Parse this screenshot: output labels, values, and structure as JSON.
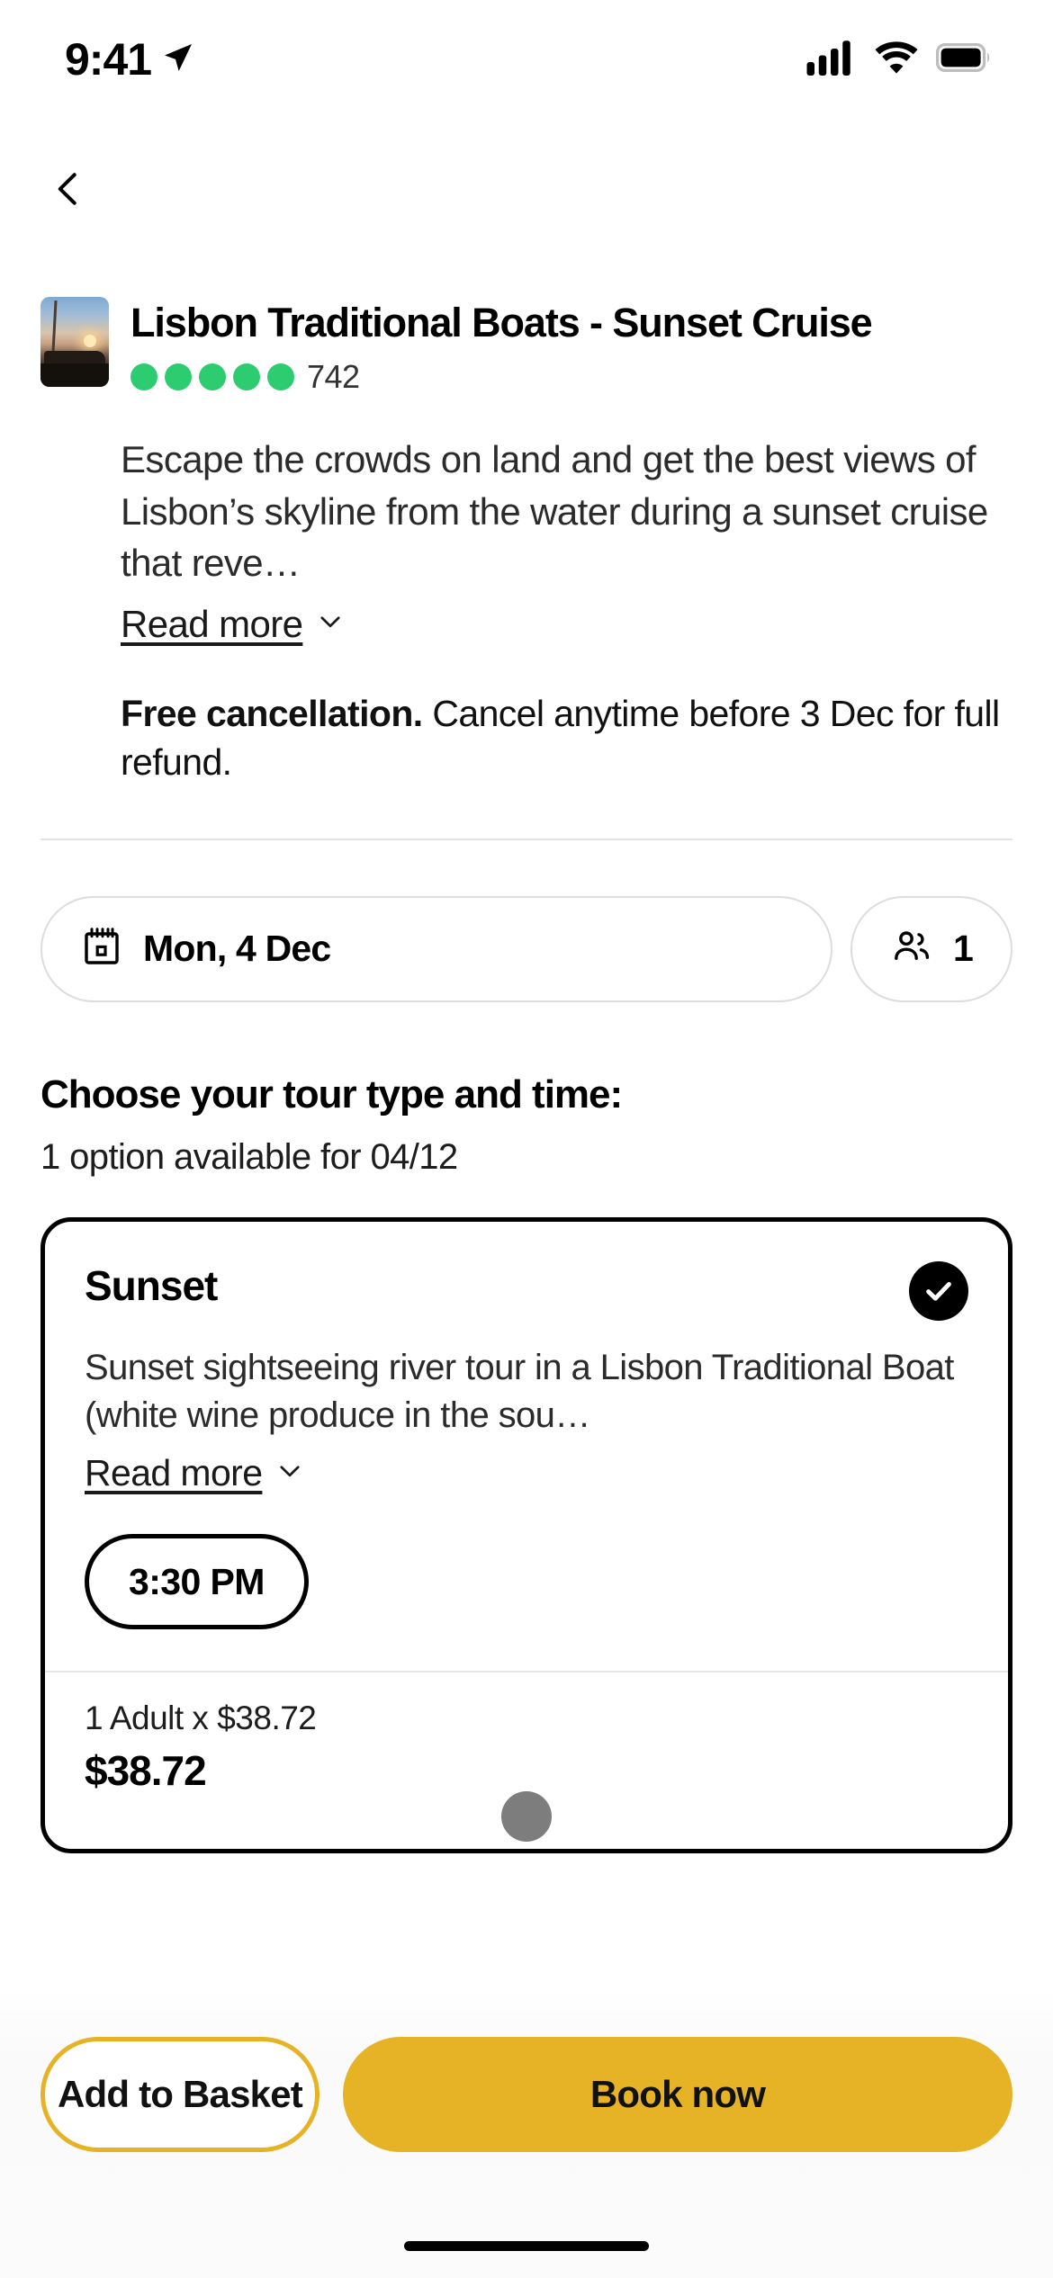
{
  "status_bar": {
    "time": "9:41",
    "location_icon": "location-arrow-icon",
    "signal_icon": "cellular-signal-icon",
    "wifi_icon": "wifi-icon",
    "battery_icon": "battery-full-icon"
  },
  "nav": {
    "back_icon": "chevron-left-icon"
  },
  "product": {
    "thumbnail_alt": "sunset-boat-thumbnail",
    "title": "Lisbon Traditional Boats - Sunset Cruise",
    "rating_dots": 5,
    "rating_color": "#2ECC71",
    "review_count": "742",
    "description": "Escape the crowds on land and get the best views of Lisbon’s skyline from the water during a sunset cruise that reve…",
    "read_more_label": "Read more",
    "read_more_icon": "chevron-down-icon",
    "cancellation_bold": "Free cancellation.",
    "cancellation_rest": " Cancel anytime before 3 Dec for full refund."
  },
  "selectors": {
    "date": {
      "icon": "calendar-icon",
      "value": "Mon, 4 Dec"
    },
    "travelers": {
      "icon": "people-icon",
      "value": "1"
    }
  },
  "choose_section": {
    "title": "Choose your tour type and time:",
    "subtitle": "1 option available for 04/12"
  },
  "option": {
    "name": "Sunset",
    "selected": true,
    "selected_icon": "check-circle-icon",
    "description": "Sunset sightseeing river tour in a Lisbon Traditional Boat (white wine produce in the sou…",
    "read_more_label": "Read more",
    "read_more_icon": "chevron-down-icon",
    "time_slot": "3:30 PM",
    "price_line": "1 Adult x $38.72",
    "price_total": "$38.72"
  },
  "sheet": {
    "drag_handle": "drag-handle"
  },
  "bottom_bar": {
    "add_to_basket_label": "Add to Basket",
    "book_now_label": "Book now",
    "accent_color": "#E5B325"
  },
  "home_indicator": "home-indicator"
}
